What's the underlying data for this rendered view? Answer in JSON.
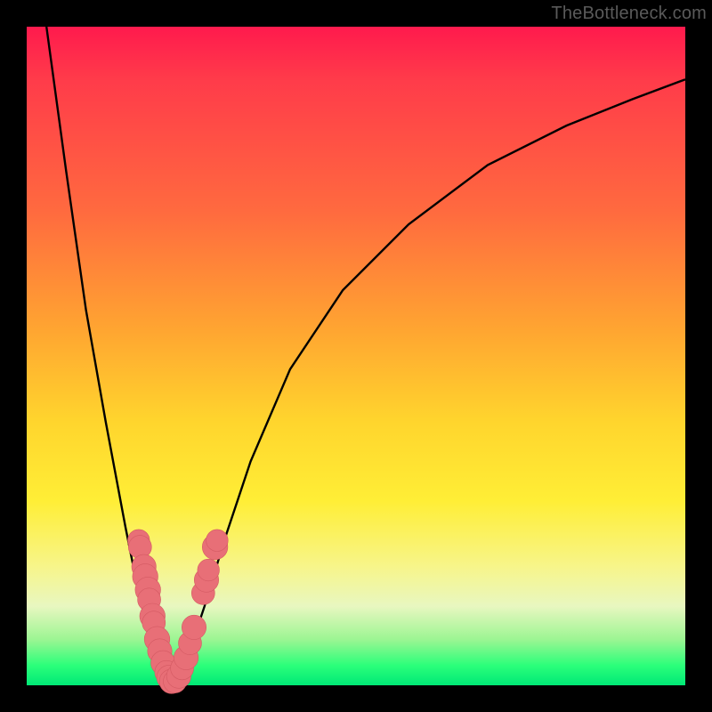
{
  "watermark": "TheBottleneck.com",
  "colors": {
    "frame": "#000000",
    "curve": "#000000",
    "dot": "#e86f77",
    "gradient_top": "#ff1a4d",
    "gradient_bottom": "#00e876"
  },
  "chart_data": {
    "type": "line",
    "title": "",
    "xlabel": "",
    "ylabel": "",
    "xlim": [
      0,
      100
    ],
    "ylim": [
      0,
      100
    ],
    "grid": false,
    "legend": false,
    "annotations": [
      "TheBottleneck.com"
    ],
    "series": [
      {
        "name": "bottleneck-curve",
        "comment": "V-shaped curve; y interpreted as bottleneck %, minimum near x≈22",
        "x": [
          3,
          6,
          9,
          12,
          15,
          17,
          19,
          20,
          21,
          22,
          23,
          24,
          25,
          27,
          30,
          34,
          40,
          48,
          58,
          70,
          82,
          92,
          100
        ],
        "y": [
          100,
          78,
          57,
          40,
          24,
          14,
          6,
          3,
          1,
          0,
          1,
          3,
          6,
          12,
          22,
          34,
          48,
          60,
          70,
          79,
          85,
          89,
          92
        ]
      }
    ],
    "scatter_overlay": {
      "name": "highlighted-points",
      "comment": "Clustered salmon dots near the trough of the V",
      "points": [
        {
          "x": 17.0,
          "y": 22.0,
          "r": 1.1
        },
        {
          "x": 17.2,
          "y": 21.0,
          "r": 1.2
        },
        {
          "x": 17.8,
          "y": 18.0,
          "r": 1.3
        },
        {
          "x": 18.0,
          "y": 16.5,
          "r": 1.4
        },
        {
          "x": 18.4,
          "y": 14.5,
          "r": 1.4
        },
        {
          "x": 18.6,
          "y": 13.0,
          "r": 1.2
        },
        {
          "x": 19.1,
          "y": 10.5,
          "r": 1.4
        },
        {
          "x": 19.3,
          "y": 9.5,
          "r": 1.2
        },
        {
          "x": 19.8,
          "y": 7.0,
          "r": 1.4
        },
        {
          "x": 20.2,
          "y": 5.2,
          "r": 1.3
        },
        {
          "x": 20.7,
          "y": 3.4,
          "r": 1.3
        },
        {
          "x": 21.2,
          "y": 2.0,
          "r": 1.2
        },
        {
          "x": 21.6,
          "y": 1.2,
          "r": 1.3
        },
        {
          "x": 22.0,
          "y": 0.6,
          "r": 1.3
        },
        {
          "x": 22.5,
          "y": 0.6,
          "r": 1.2
        },
        {
          "x": 23.1,
          "y": 1.4,
          "r": 1.3
        },
        {
          "x": 23.6,
          "y": 2.6,
          "r": 1.2
        },
        {
          "x": 24.2,
          "y": 4.2,
          "r": 1.3
        },
        {
          "x": 24.8,
          "y": 6.4,
          "r": 1.2
        },
        {
          "x": 25.4,
          "y": 8.8,
          "r": 1.3
        },
        {
          "x": 26.8,
          "y": 14.0,
          "r": 1.2
        },
        {
          "x": 27.3,
          "y": 16.0,
          "r": 1.3
        },
        {
          "x": 27.6,
          "y": 17.5,
          "r": 1.1
        },
        {
          "x": 28.6,
          "y": 21.0,
          "r": 1.4
        },
        {
          "x": 28.9,
          "y": 22.0,
          "r": 1.1
        }
      ]
    }
  }
}
